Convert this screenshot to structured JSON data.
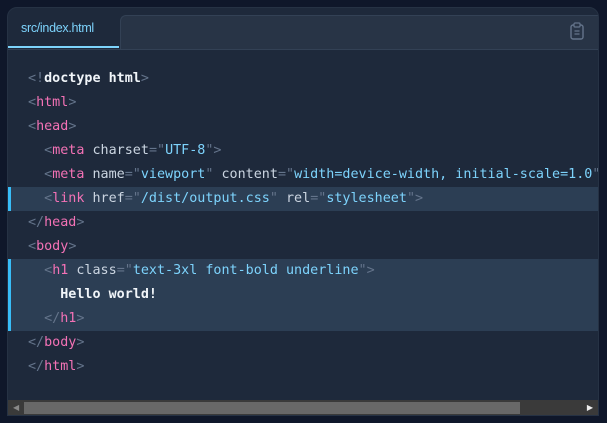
{
  "tab": {
    "label": "src/index.html"
  },
  "copy_icon": "clipboard-icon",
  "colors": {
    "accent": "#7dd3fc",
    "tag": "#f472b6",
    "highlight": "#2c3e54",
    "bar": "#38bdf8"
  },
  "lines": [
    {
      "hl": false,
      "tokens": [
        [
          "p",
          "<!"
        ],
        [
          "kw",
          "doctype html"
        ],
        [
          "p",
          ">"
        ]
      ]
    },
    {
      "hl": false,
      "tokens": [
        [
          "p",
          "<"
        ],
        [
          "tag",
          "html"
        ],
        [
          "p",
          ">"
        ]
      ]
    },
    {
      "hl": false,
      "tokens": [
        [
          "p",
          "<"
        ],
        [
          "tag",
          "head"
        ],
        [
          "p",
          ">"
        ]
      ]
    },
    {
      "hl": false,
      "tokens": [
        [
          "p",
          "  <"
        ],
        [
          "tag",
          "meta"
        ],
        [
          "attr",
          " charset"
        ],
        [
          "p",
          "=\""
        ],
        [
          "str",
          "UTF-8"
        ],
        [
          "p",
          "\">"
        ]
      ]
    },
    {
      "hl": false,
      "tokens": [
        [
          "p",
          "  <"
        ],
        [
          "tag",
          "meta"
        ],
        [
          "attr",
          " name"
        ],
        [
          "p",
          "=\""
        ],
        [
          "str",
          "viewport"
        ],
        [
          "p",
          "\""
        ],
        [
          "attr",
          " content"
        ],
        [
          "p",
          "=\""
        ],
        [
          "str",
          "width=device-width, initial-scale=1.0"
        ],
        [
          "p",
          "\">"
        ]
      ]
    },
    {
      "hl": true,
      "bar": true,
      "tokens": [
        [
          "p",
          "  <"
        ],
        [
          "tag",
          "link"
        ],
        [
          "attr",
          " href"
        ],
        [
          "p",
          "=\""
        ],
        [
          "str",
          "/dist/output.css"
        ],
        [
          "p",
          "\""
        ],
        [
          "attr",
          " rel"
        ],
        [
          "p",
          "=\""
        ],
        [
          "str",
          "stylesheet"
        ],
        [
          "p",
          "\">"
        ]
      ]
    },
    {
      "hl": false,
      "tokens": [
        [
          "p",
          "</"
        ],
        [
          "tag",
          "head"
        ],
        [
          "p",
          ">"
        ]
      ]
    },
    {
      "hl": false,
      "tokens": [
        [
          "p",
          "<"
        ],
        [
          "tag",
          "body"
        ],
        [
          "p",
          ">"
        ]
      ]
    },
    {
      "hl": true,
      "bar": true,
      "tokens": [
        [
          "p",
          "  <"
        ],
        [
          "tag",
          "h1"
        ],
        [
          "attr",
          " class"
        ],
        [
          "p",
          "=\""
        ],
        [
          "str",
          "text-3xl font-bold underline"
        ],
        [
          "p",
          "\">"
        ]
      ]
    },
    {
      "hl": true,
      "bar": true,
      "tokens": [
        [
          "txt",
          "    Hello world!"
        ]
      ]
    },
    {
      "hl": true,
      "bar": true,
      "tokens": [
        [
          "p",
          "  </"
        ],
        [
          "tag",
          "h1"
        ],
        [
          "p",
          ">"
        ]
      ]
    },
    {
      "hl": false,
      "tokens": [
        [
          "p",
          "</"
        ],
        [
          "tag",
          "body"
        ],
        [
          "p",
          ">"
        ]
      ]
    },
    {
      "hl": false,
      "tokens": [
        [
          "p",
          "</"
        ],
        [
          "tag",
          "html"
        ],
        [
          "p",
          ">"
        ]
      ]
    }
  ]
}
